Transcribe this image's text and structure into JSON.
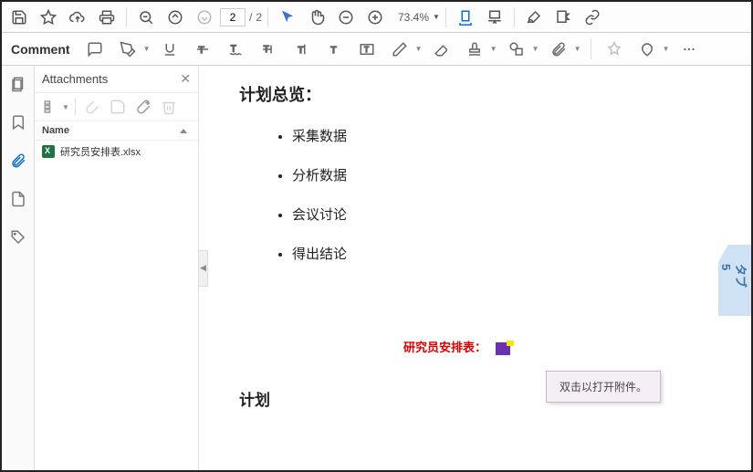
{
  "toolbar": {
    "page_current": "2",
    "page_sep": "/",
    "page_total": "2",
    "zoom_value": "73.4%"
  },
  "comment_bar": {
    "label": "Comment"
  },
  "rail": {
    "items": [
      "pages",
      "bookmarks",
      "attachments",
      "file",
      "tags"
    ]
  },
  "attachments": {
    "title": "Attachments",
    "col_name": "Name",
    "items": [
      {
        "filename": "研究员安排表.xlsx"
      }
    ]
  },
  "document": {
    "heading1": "计划总览：",
    "bullets": [
      "采集数据",
      "分析数据",
      "会议讨论",
      "得出结论"
    ],
    "red_label": "研究员安排表：",
    "heading2": "计划"
  },
  "side_tab": {
    "label": "タブ 5"
  },
  "tooltip": {
    "text": "双击以打开附件。"
  }
}
